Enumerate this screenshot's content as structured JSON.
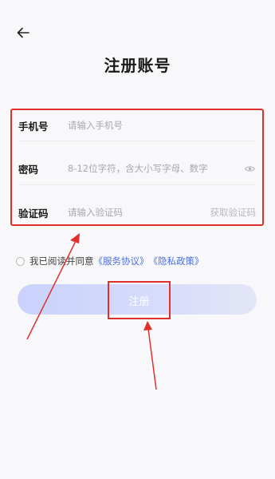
{
  "header": {
    "back_icon": "arrow-left-icon",
    "title": "注册账号"
  },
  "form": {
    "phone": {
      "label": "手机号",
      "placeholder": "请输入手机号"
    },
    "password": {
      "label": "密码",
      "placeholder": "8-12位字符，含大小写字母、数字",
      "toggle_icon": "eye-icon"
    },
    "code": {
      "label": "验证码",
      "placeholder": "请输入验证码",
      "get_code_label": "获取验证码"
    }
  },
  "agreement": {
    "prefix": "我已阅读并同意",
    "service_link": "《服务协议》",
    "privacy_link": "《隐私政策》"
  },
  "register_button": {
    "label": "注册"
  },
  "colors": {
    "highlight": "#e0302c",
    "link": "#4b6fe0",
    "button_gradient_start": "#c9d2fb",
    "button_gradient_end": "#e3e6f6"
  }
}
